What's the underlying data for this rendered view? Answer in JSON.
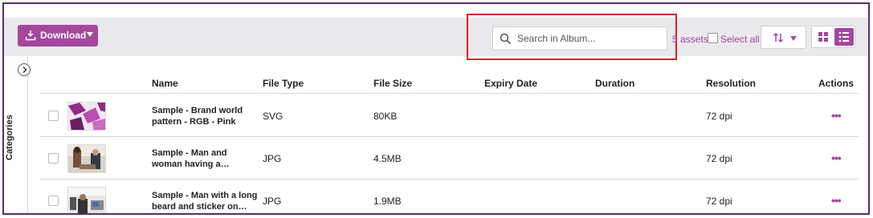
{
  "toolbar": {
    "download_label": "Download",
    "search_placeholder": "Search in Album...",
    "search_value": "",
    "assets_count": "5 assets",
    "select_all_label": "Select all"
  },
  "sidebar": {
    "categories_label": "Categories"
  },
  "table": {
    "headers": {
      "name": "Name",
      "file_type": "File Type",
      "file_size": "File Size",
      "expiry_date": "Expiry Date",
      "duration": "Duration",
      "resolution": "Resolution",
      "actions": "Actions"
    },
    "rows": [
      {
        "name": "Sample - Brand world pattern - RGB - Pink",
        "file_type": "SVG",
        "file_size": "80KB",
        "expiry_date": "",
        "duration": "",
        "resolution": "72 dpi",
        "actions": "•••"
      },
      {
        "name": "Sample - Man and woman having a discussion wit…",
        "file_type": "JPG",
        "file_size": "4.5MB",
        "expiry_date": "",
        "duration": "",
        "resolution": "72 dpi",
        "actions": "•••"
      },
      {
        "name": "Sample - Man with a long beard and sticker on his…",
        "file_type": "JPG",
        "file_size": "1.9MB",
        "expiry_date": "",
        "duration": "",
        "resolution": "72 dpi",
        "actions": "•••"
      }
    ]
  },
  "colors": {
    "accent": "#a4479d",
    "frame": "#5b2b6e",
    "highlight": "#e02020",
    "toolbar_bg": "#e9e9ed"
  },
  "icons": {
    "download": "download-tray-icon",
    "search": "magnifier-icon",
    "sort": "sort-arrows-icon",
    "grid": "grid-view-icon",
    "list": "list-view-icon",
    "expand": "chevron-right-icon",
    "actions": "more-horizontal-icon"
  }
}
